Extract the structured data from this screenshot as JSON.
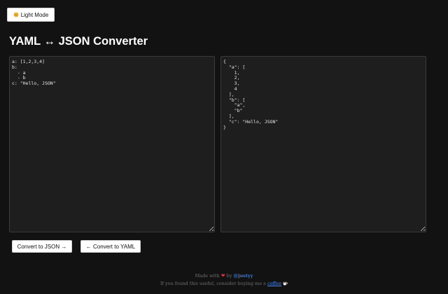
{
  "header": {
    "theme_label": "Light Mode",
    "theme_icon": "sun-icon",
    "title": "YAML ↔ JSON Converter"
  },
  "editors": {
    "yaml_value": "a: [1,2,3,4]\nb:\n  - a\n  - b\nc: \"Hello, JSON\"",
    "json_value": "{\n  \"a\": [\n    1,\n    2,\n    3,\n    4\n  ],\n  \"b\": [\n    \"a\",\n    \"b\"\n  ],\n  \"c\": \"Hello, JSON\"\n}"
  },
  "actions": {
    "to_json_label": "Convert to JSON →",
    "to_yaml_label": "← Convert to YAML"
  },
  "footer": {
    "made_with": "Made with",
    "heart": "❤",
    "by": "by",
    "author": "@justyy",
    "support_text": "If you found this useful, consider buying me a",
    "coffee_link": "coffee",
    "cup_icon": "coffee-cup-icon"
  },
  "colors": {
    "background": "#121212",
    "editor_bg": "#1e1e1e",
    "link": "#3b7de0",
    "heart": "#e0314b"
  }
}
